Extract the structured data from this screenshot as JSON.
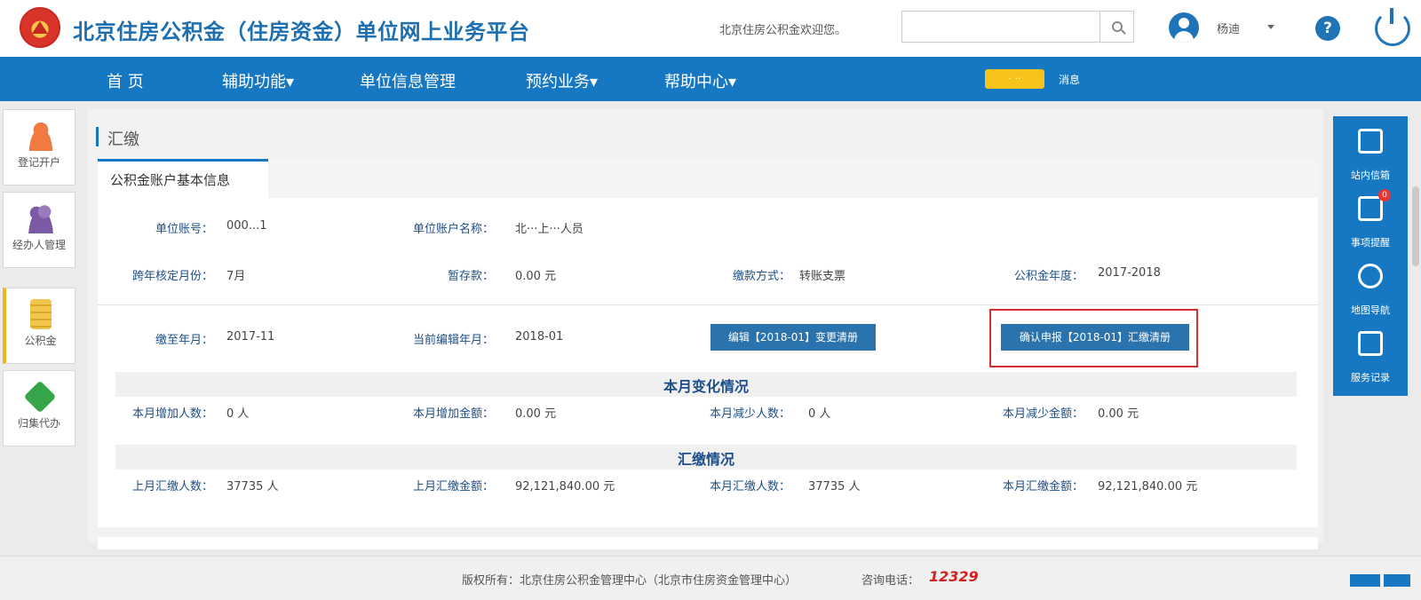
{
  "header": {
    "title": "北京住房公积金（住房资金）单位网上业务平台",
    "welcome": "北京住房公积金欢迎您。",
    "search_placeholder": "",
    "user_name": "杨迪"
  },
  "nav": {
    "items": [
      "首 页",
      "辅助功能▾",
      "单位信息管理",
      "预约业务▾",
      "帮助中心▾"
    ],
    "badge": "·  ··",
    "small_text": "消息"
  },
  "sidebar": {
    "items": [
      {
        "label": "登记开户",
        "icon": "user-add-icon"
      },
      {
        "label": "经办人管理",
        "icon": "users-icon"
      },
      {
        "label": "公积金",
        "icon": "coins-icon"
      },
      {
        "label": "归集代办",
        "icon": "tag-icon"
      }
    ]
  },
  "rightbar": {
    "items": [
      {
        "label": "站内信箱",
        "icon": "mailbox-icon"
      },
      {
        "label": "事项提醒",
        "icon": "reminder-icon",
        "badge": "0"
      },
      {
        "label": "地图导航",
        "icon": "alarm-clock-icon"
      },
      {
        "label": "服务记录",
        "icon": "calculator-icon"
      }
    ]
  },
  "main": {
    "page_title": "汇缴",
    "card_tab": "公积金账户基本信息",
    "fields": {
      "unit_no_label": "单位账号：",
      "unit_no_value": "000...1",
      "account_name_label": "单位账户名称：",
      "account_name_value": "北···上···人员",
      "verify_month_label": "跨年核定月份：",
      "verify_month_value": "7月",
      "temp_deposit_label": "暂存款：",
      "temp_deposit_value": "0.00 元",
      "payment_method_label": "缴款方式：",
      "payment_method_value": "转账支票",
      "fund_year_label": "公积金年度：",
      "fund_year_value": "2017-2018",
      "paid_until_label": "缴至年月：",
      "paid_until_value": "2017-11",
      "current_month_label": "当前编辑年月：",
      "current_month_value": "2018-01",
      "edit_button": "编辑【2018-01】变更清册",
      "confirm_button": "确认申报【2018-01】汇缴清册"
    },
    "month_changes": {
      "title": "本月变化情况",
      "add_people_label": "本月增加人数：",
      "add_people_value": "0 人",
      "add_amount_label": "本月增加金额：",
      "add_amount_value": "0.00 元",
      "reduce_people_label": "本月减少人数：",
      "reduce_people_value": "0 人",
      "reduce_amount_label": "本月减少金额：",
      "reduce_amount_value": "0.00 元"
    },
    "summary": {
      "title": "汇缴情况",
      "last_people_label": "上月汇缴人数：",
      "last_people_value": "37735 人",
      "last_amount_label": "上月汇缴金额：",
      "last_amount_value": "92,121,840.00 元",
      "this_people_label": "本月汇缴人数：",
      "this_people_value": "37735 人",
      "this_amount_label": "本月汇缴金额：",
      "this_amount_value": "92,121,840.00 元"
    }
  },
  "footer": {
    "copyright": "版权所有：北京住房公积金管理中心（北京市住房资金管理中心）",
    "hotline_label": "咨询电话：",
    "hotline": "12329"
  },
  "colors": {
    "brand_blue": "#1678c2",
    "title_blue": "#1d6fb0",
    "highlight_red": "#d62f2f",
    "hotline_red": "#d21f1f"
  }
}
